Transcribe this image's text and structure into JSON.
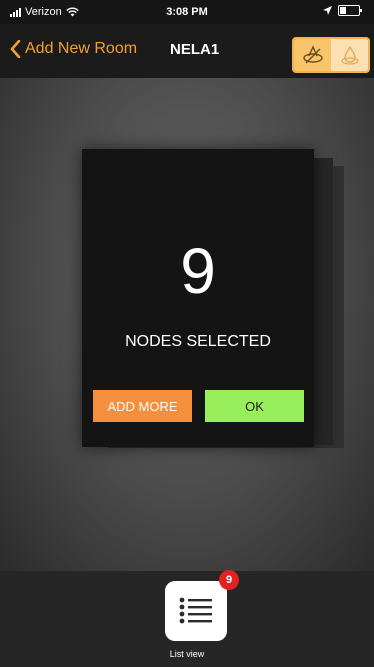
{
  "status_bar": {
    "carrier": "Verizon",
    "time": "3:08 PM"
  },
  "nav": {
    "back_label": "Add New Room",
    "title": "NELA1",
    "accent_color": "#f3a02b"
  },
  "selection_card": {
    "count": "9",
    "label": "NODES SELECTED",
    "add_more_label": "ADD MORE",
    "ok_label": "OK",
    "add_more_color": "#f58e3d",
    "ok_color": "#98ee5b"
  },
  "bottom_bar": {
    "list_view_label": "List view",
    "badge_count": "9",
    "icon": "list-icon"
  }
}
